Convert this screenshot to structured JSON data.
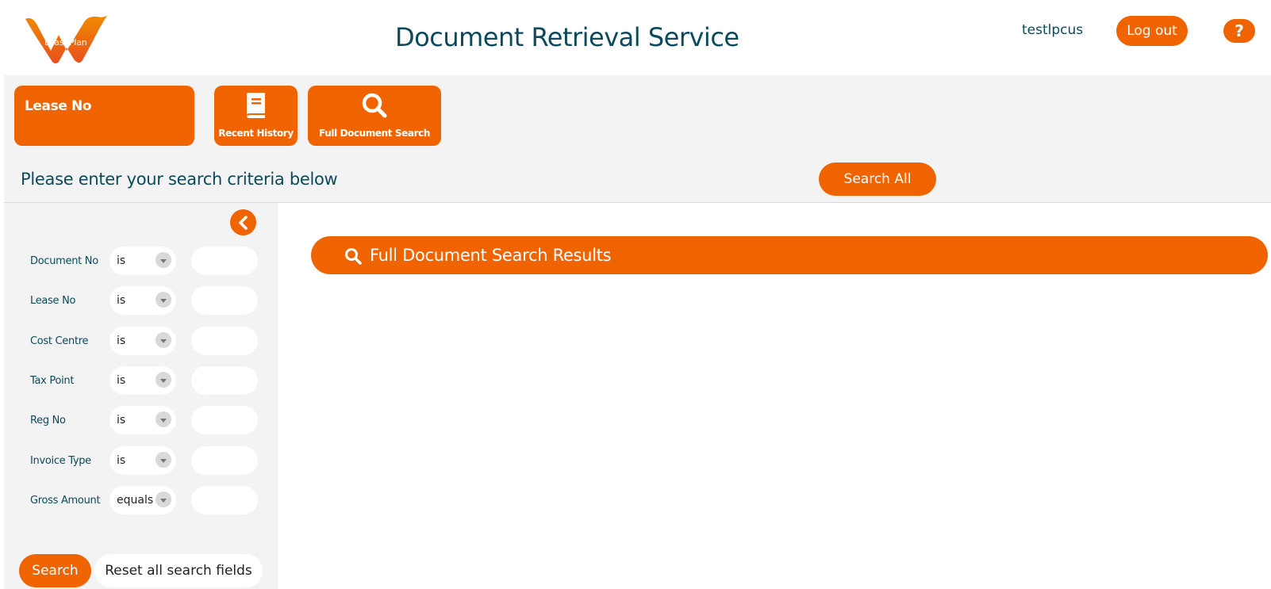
{
  "header": {
    "logo_text": "LeasePlan",
    "title": "Document Retrieval Service",
    "username": "testlpcus",
    "logout_label": "Log out",
    "help_label": "?"
  },
  "toolbar": {
    "lease_tile_label": "Lease No",
    "recent_history_label": "Recent History",
    "full_search_label": "Full Document Search"
  },
  "criteria": {
    "instructions": "Please enter your search criteria below",
    "search_all_label": "Search All"
  },
  "filters": [
    {
      "label": "Document No",
      "operator": "is",
      "value": ""
    },
    {
      "label": "Lease No",
      "operator": "is",
      "value": ""
    },
    {
      "label": "Cost Centre",
      "operator": "is",
      "value": ""
    },
    {
      "label": "Tax Point",
      "operator": "is",
      "value": ""
    },
    {
      "label": "Reg No",
      "operator": "is",
      "value": ""
    },
    {
      "label": "Invoice Type",
      "operator": "is",
      "value": ""
    },
    {
      "label": "Gross Amount",
      "operator": "equals",
      "value": ""
    }
  ],
  "sidebar_actions": {
    "search_label": "Search",
    "reset_label": "Reset all search fields"
  },
  "results": {
    "title": "Full Document Search Results"
  },
  "colors": {
    "accent": "#f06400",
    "text": "#0b4a5a",
    "panel": "#f3f3f3"
  },
  "icons": {
    "logo": "leaseplan-logo-icon",
    "recent_history": "book-icon",
    "full_search": "search-icon",
    "collapse": "chevron-left-icon",
    "dropdown": "caret-down-icon"
  }
}
